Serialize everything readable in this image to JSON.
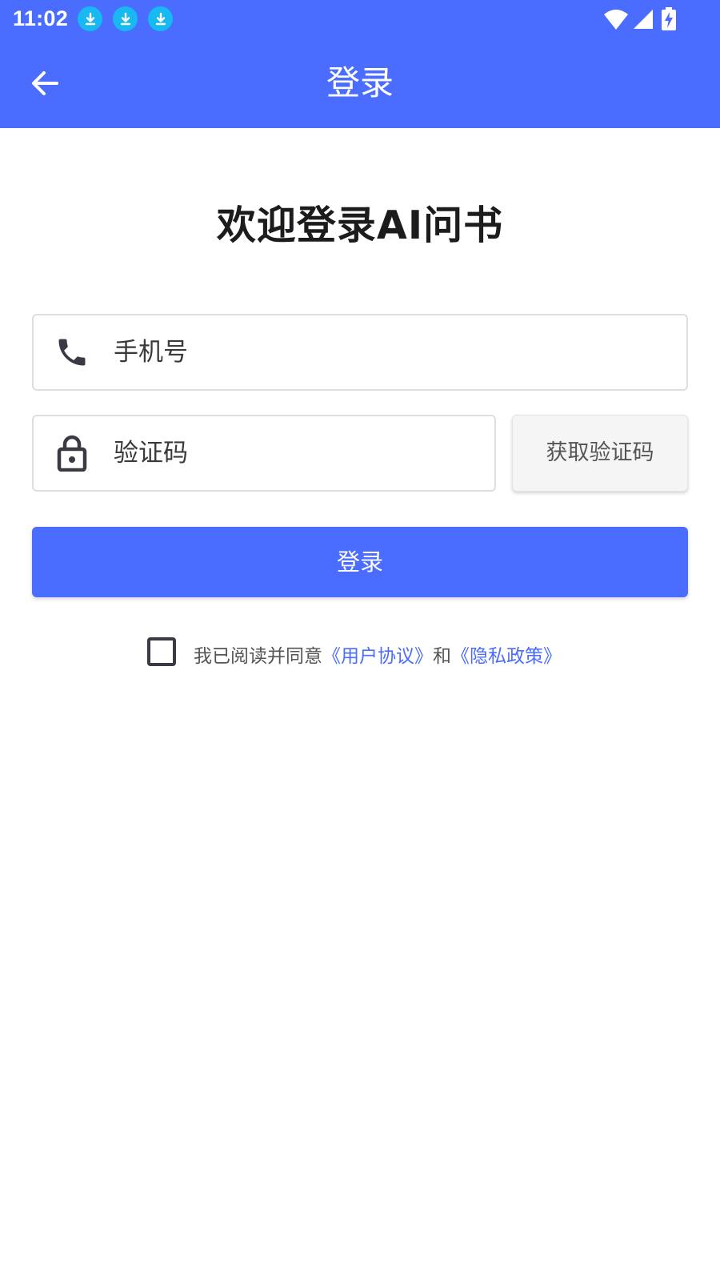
{
  "status_bar": {
    "time": "11:02",
    "notification_icons": [
      "download-icon",
      "download-icon",
      "download-icon"
    ],
    "right_icons": [
      "wifi-icon",
      "signal-icon",
      "battery-charging-icon"
    ]
  },
  "app_bar": {
    "back_icon": "arrow-left-icon",
    "title": "登录"
  },
  "welcome_title": "欢迎登录AI问书",
  "form": {
    "phone": {
      "icon": "phone-icon",
      "placeholder": "手机号",
      "value": ""
    },
    "code": {
      "icon": "lock-icon",
      "placeholder": "验证码",
      "value": ""
    },
    "get_code_label": "获取验证码",
    "login_label": "登录"
  },
  "agreement": {
    "checked": false,
    "prefix": "我已阅读并同意",
    "user_agreement": "《用户协议》",
    "conjunction": "和",
    "privacy_policy": "《隐私政策》"
  },
  "colors": {
    "primary": "#4a6cff",
    "notification_icon": "#18b8f0",
    "title_text": "#1c1c1e"
  }
}
